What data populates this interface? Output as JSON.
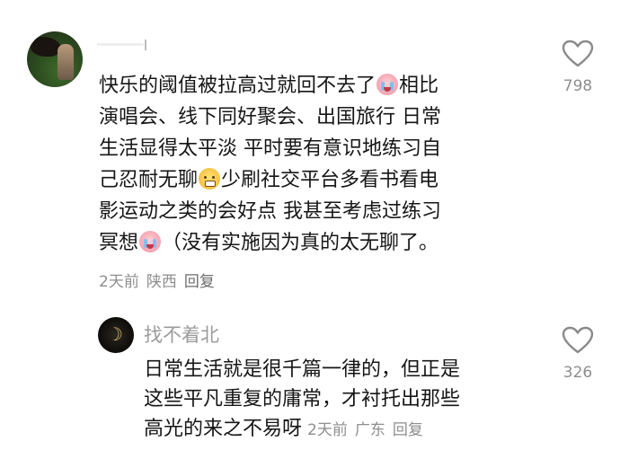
{
  "comment": {
    "username": "",
    "text_line1": "快乐的阈值被拉高过就回不去了",
    "text_line1_end": "相比",
    "text_line2": "演唱会、线下同好聚会、出国旅行 日常",
    "text_line3": "生活显得太平淡 平时要有意识地练习自",
    "text_line4_start": "己忍耐无聊",
    "text_line4_end": "少刷社交平台多看书看电",
    "text_line5": "影运动之类的会好点 我甚至考虑过练习",
    "text_line6_start": "冥想",
    "text_line6_end": "（没有实施因为真的太无聊了。",
    "time": "2天前",
    "location": "陕西",
    "reply_label": "回复",
    "like_count": "798",
    "emojis": [
      "crying-face-icon",
      "sweating-face-icon",
      "crying-face-icon"
    ]
  },
  "reply": {
    "username": "找不着北",
    "text_line1": "日常生活就是很千篇一律的，但正是",
    "text_line2": "这些平凡重复的庸常，才衬托出那些",
    "text_line3": "高光的来之不易呀",
    "time": "2天前",
    "location": "广东",
    "reply_label": "回复",
    "like_count": "326"
  },
  "colors": {
    "text": "#161616",
    "meta": "#8e8e8e",
    "reply_name": "#9b9b9b",
    "heart_outline": "#8a8a8a"
  }
}
